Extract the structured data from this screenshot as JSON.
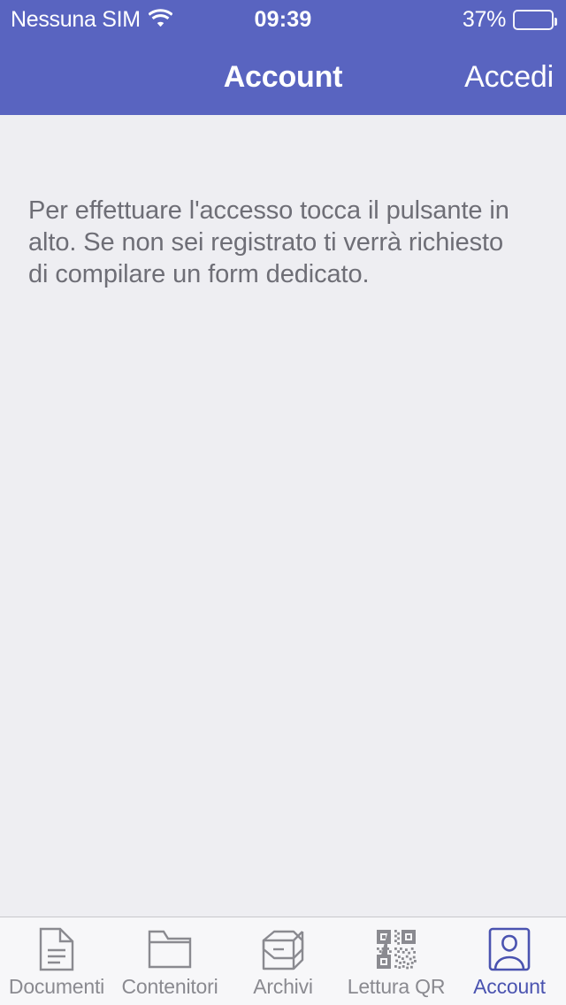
{
  "status_bar": {
    "carrier": "Nessuna SIM",
    "wifi_icon": "wifi-icon",
    "time": "09:39",
    "battery_percent_label": "37%",
    "battery_level": 37,
    "battery_icon": "battery-icon",
    "background_color": "#5964c0",
    "text_color": "#ffffff"
  },
  "nav_bar": {
    "title": "Account",
    "login_label": "Accedi",
    "background_color": "#5964c0",
    "text_color": "#ffffff"
  },
  "content": {
    "info_text": "Per effettuare l'accesso tocca il pulsante in alto. Se non sei registrato ti verrà richiesto di compilare un form dedicato.",
    "background_color": "#eeeef2",
    "text_color": "#6e6e76"
  },
  "tab_bar": {
    "background_color": "#f7f7f9",
    "inactive_color": "#8a8a90",
    "active_color": "#4a53b0",
    "active_index": 4,
    "items": [
      {
        "label": "Documenti",
        "icon": "document-icon"
      },
      {
        "label": "Contenitori",
        "icon": "folder-icon"
      },
      {
        "label": "Archivi",
        "icon": "box-icon"
      },
      {
        "label": "Lettura QR",
        "icon": "qr-code-icon"
      },
      {
        "label": "Account",
        "icon": "person-frame-icon"
      }
    ]
  }
}
